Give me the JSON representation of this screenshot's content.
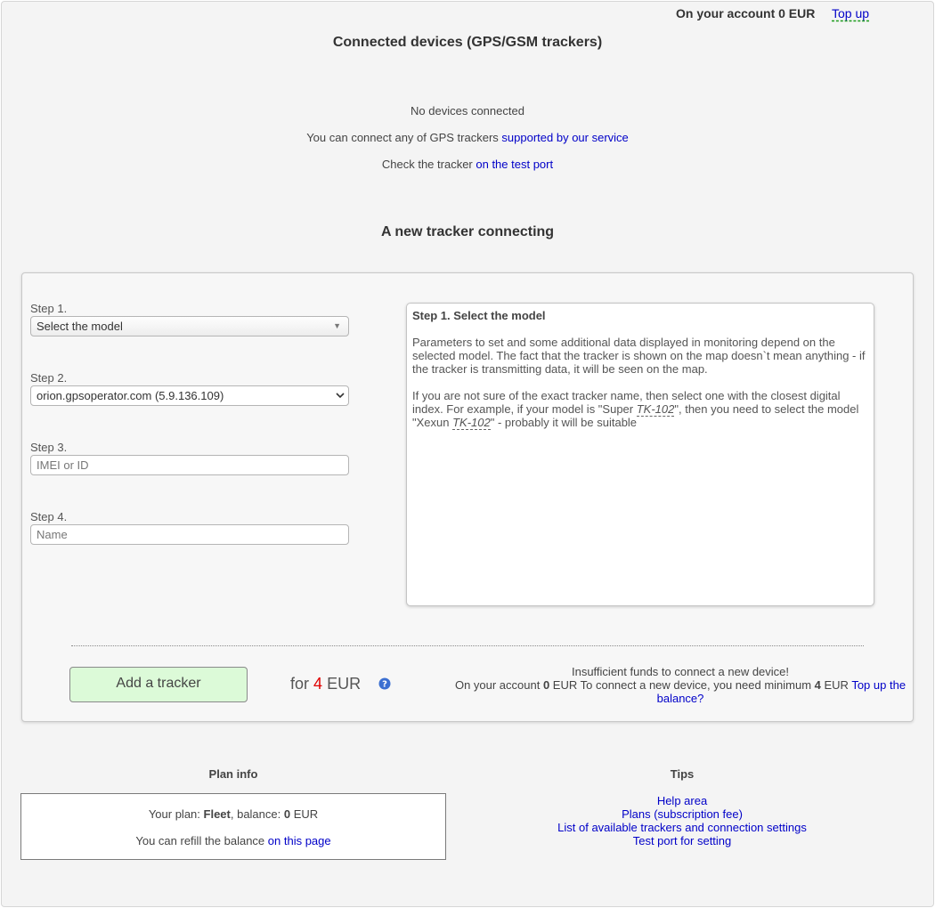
{
  "header": {
    "account_text": "On your account 0 EUR",
    "topup_label": "Top up"
  },
  "devices": {
    "title": "Connected devices (GPS/GSM trackers)",
    "empty_text": "No devices connected",
    "connect_text": "You can connect any of GPS trackers",
    "connect_link": "supported by our service",
    "check_text": "Check the tracker",
    "check_link": "on the test port"
  },
  "new_tracker": {
    "title": "A new tracker connecting",
    "step1_label": "Step 1.",
    "step1_value": "Select the model",
    "step2_label": "Step 2.",
    "step2_value": "orion.gpsoperator.com (5.9.136.109)",
    "step3_label": "Step 3.",
    "step3_placeholder": "IMEI or ID",
    "step4_label": "Step 4.",
    "step4_placeholder": "Name",
    "help": {
      "title": "Step 1. Select the model",
      "p1": "Parameters to set and some additional data displayed in monitoring depend on the selected model. The fact that the tracker is shown on the map doesn`t mean anything - if the tracker is transmitting data, it will be seen on the map.",
      "p2_a": "If you are not sure of the exact tracker name, then select one with the closest digital index. For example, if your model is \"Super ",
      "p2_model1": "TK-102",
      "p2_b": "\", then you need to select the model \"Xexun ",
      "p2_model2": "TK-102",
      "p2_c": "\" - probably it will be suitable"
    },
    "add_button": "Add a tracker",
    "price_prefix": "for",
    "price_value": "4",
    "price_currency": "EUR",
    "funds_line1": "Insufficient funds to connect a new device!",
    "funds_a": "On your account ",
    "funds_balance": "0",
    "funds_b": " EUR To connect a new device, you need minimum ",
    "funds_min": "4",
    "funds_c": " EUR ",
    "funds_link": "Top up the balance?"
  },
  "plan": {
    "title": "Plan info",
    "plan_prefix": "Your plan: ",
    "plan_name": "Fleet",
    "balance_prefix": ", balance: ",
    "balance_value": "0",
    "balance_suffix": " EUR",
    "refill_text": "You can refill the balance ",
    "refill_link": "on this page"
  },
  "tips": {
    "title": "Tips",
    "links": [
      "Help area",
      "Plans (subscription fee)",
      "List of available trackers and connection settings",
      "Test port for setting"
    ]
  },
  "colors": {
    "link": "#0000c8",
    "price_accent": "#e00000",
    "button_bg": "#dcfad8",
    "info_icon": "#3b6fd1"
  },
  "icons": {
    "info": "question-circle-icon",
    "select_arrow": "chevron-down-icon"
  }
}
